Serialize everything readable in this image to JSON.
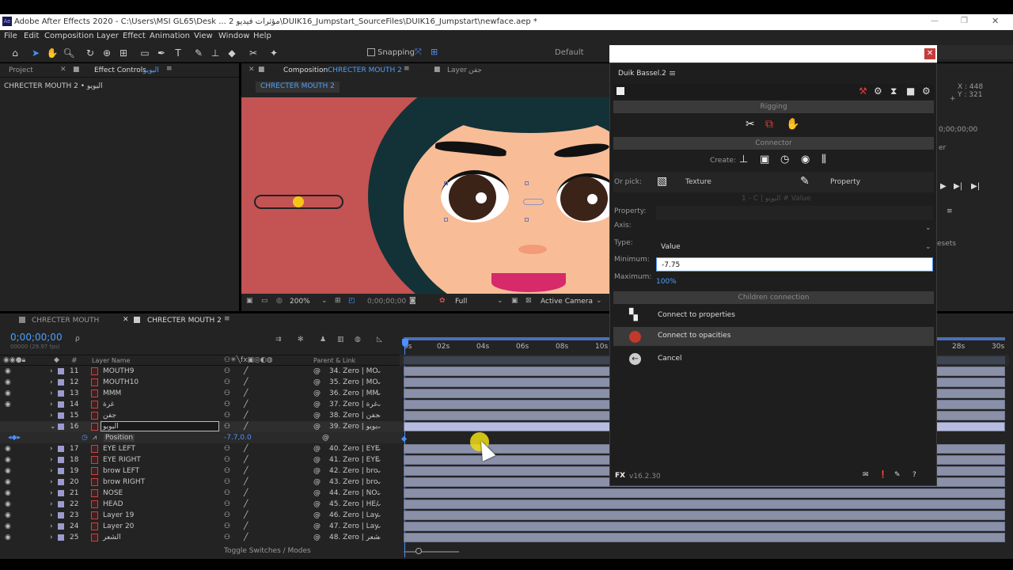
{
  "window": {
    "title": "Adobe After Effects 2020 - C:\\Users\\MSI GL65\\Desk ... 2 مؤثرات فيديو\\DUIK16_Jumpstart_SourceFiles\\DUIK16_Jumpstart\\newface.aep *",
    "controls": {
      "minimize": "—",
      "restore": "❐",
      "close": "✕"
    }
  },
  "menu": [
    "File",
    "Edit",
    "Composition",
    "Layer",
    "Effect",
    "Animation",
    "View",
    "Window",
    "Help"
  ],
  "toolbar": {
    "snapping": "Snapping",
    "workspace": "Default"
  },
  "left_panel": {
    "tab_project": "Project",
    "tab_effect_controls": "Effect Controls",
    "effect_layer_name": "اليويو",
    "breadcrumb": "CHRECTER MOUTH 2 • اليويو"
  },
  "comp_panel": {
    "tab_label": "Composition",
    "comp_name": "CHRECTER MOUTH 2",
    "layer_tab_label": "Layer",
    "layer_tab_name": "جفن",
    "active_tag": "CHRECTER MOUTH 2",
    "zoom": "200%",
    "timecode": "0;00;00;00",
    "resolution": "Full",
    "camera": "Active Camera"
  },
  "timeline": {
    "tab1": "CHRECTER MOUTH",
    "tab2": "CHRECTER MOUTH 2",
    "timecode": "0;00;00;00",
    "fps": "00000 (29.97 fps)",
    "search_placeholder": "ρ",
    "col_hash": "#",
    "col_layer_name": "Layer Name",
    "col_parent": "Parent & Link",
    "ruler": [
      "0s",
      "02s",
      "04s",
      "06s",
      "08s",
      "10s",
      "28s",
      "30s"
    ],
    "toggle_label": "Toggle Switches / Modes",
    "position_label": "Position",
    "position_value": "-7.7,0.0",
    "layers": [
      {
        "num": "11",
        "name": "MOUTH9",
        "parent": "34. Zero | MO"
      },
      {
        "num": "12",
        "name": "MOUTH10",
        "parent": "35. Zero | MO"
      },
      {
        "num": "13",
        "name": "MMM",
        "parent": "36. Zero | MM"
      },
      {
        "num": "14",
        "name": "غرة",
        "parent": "37. Zero | غرة"
      },
      {
        "num": "15",
        "name": "جفن",
        "parent": "38. Zero | جفن"
      },
      {
        "num": "16",
        "name": "اليويو",
        "parent": "39. Zero | يويو"
      },
      {
        "num": "17",
        "name": "EYE LEFT",
        "parent": "40. Zero | EYE"
      },
      {
        "num": "18",
        "name": "EYE RIGHT",
        "parent": "41. Zero | EYE"
      },
      {
        "num": "19",
        "name": "brow LEFT",
        "parent": "42. Zero | bro"
      },
      {
        "num": "20",
        "name": "brow RIGHT",
        "parent": "43. Zero | bro"
      },
      {
        "num": "21",
        "name": "NOSE",
        "parent": "44. Zero | NO:"
      },
      {
        "num": "22",
        "name": "HEAD",
        "parent": "45. Zero | HE/"
      },
      {
        "num": "23",
        "name": "Layer 19",
        "parent": "46. Zero | Lay"
      },
      {
        "num": "24",
        "name": "Layer 20",
        "parent": "47. Zero | Lay"
      },
      {
        "num": "25",
        "name": "الشعر",
        "parent": "48. Zero | شعر"
      }
    ]
  },
  "right_panel": {
    "coord_x": "X : 448",
    "coord_y": "Y : 321",
    "timecode": "0;00;00;00",
    "label_er": "er",
    "label_sets": "esets"
  },
  "duik": {
    "title": "Duik Bassel.2",
    "section_rigging": "Rigging",
    "section_connector": "Connector",
    "create_label": "Create:",
    "or_pick_label": "Or pick:",
    "texture_label": "Texture",
    "property_label": "Property",
    "hint": "1 - C | اليويو # Value",
    "property_field_label": "Property:",
    "axis_label": "Axis:",
    "type_label": "Type:",
    "type_value": "Value",
    "minimum_label": "Minimum:",
    "minimum_value": "-7.75",
    "maximum_label": "Maximum:",
    "maximum_value": "100%",
    "section_children": "Children connection",
    "connect_properties": "Connect to properties",
    "connect_opacities": "Connect to opacities",
    "cancel": "Cancel",
    "version": "v16.2.30",
    "fx_label": "FX"
  }
}
